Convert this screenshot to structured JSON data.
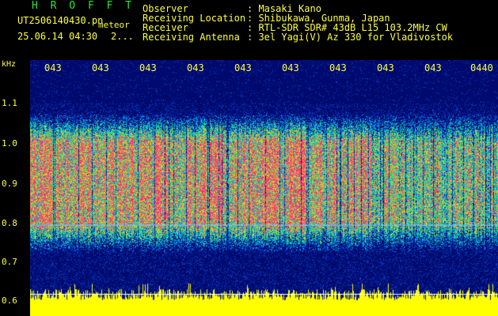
{
  "header": {
    "brand": "H R O F F T",
    "filename": "UT2506140430.pn",
    "mode": "meteor",
    "datetime": "25.06.14 04:30",
    "index": "2..."
  },
  "info": [
    {
      "label": "Observer",
      "value": ": Masaki Kano"
    },
    {
      "label": "Receiving Location",
      "value": ": Shibukawa, Gunma, Japan"
    },
    {
      "label": "Receiver",
      "value": ": RTL-SDR SDR# 43dB L15 103.2MHz CW"
    },
    {
      "label": "Receiving Antenna",
      "value": ": 3el Yagi(V) Az 330 for Vladivostok"
    }
  ],
  "axis": {
    "y_unit": "kHz",
    "y_ticks": [
      "1.1",
      "1.0",
      "0.9",
      "0.8",
      "0.7",
      "0.6"
    ],
    "x_ticks": [
      "043",
      "043",
      "043",
      "043",
      "043",
      "043",
      "043",
      "043",
      "043",
      "0440"
    ]
  },
  "colors": {
    "background": "#000000",
    "text": "#ffff3a",
    "brand": "#2fe33a",
    "signal_core": "#ff1a6e",
    "signal_edge": "#00c8ff",
    "noise": "#0a2aa0",
    "level_bar": "#ffff00"
  }
}
